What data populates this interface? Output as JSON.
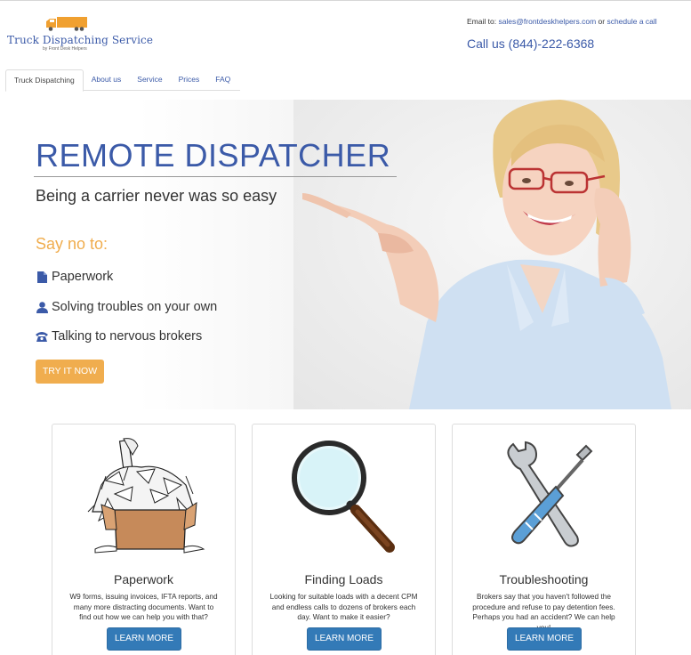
{
  "header": {
    "logo_title": "Truck Dispatching Service",
    "logo_subtitle": "by Front Desk Helpers",
    "email_prefix": "Email to: ",
    "email": "sales@frontdeskhelpers.com",
    "or_text": " or ",
    "schedule_link": "schedule a call",
    "call": "Call us (844)-222-6368"
  },
  "nav": {
    "items": [
      {
        "label": "Truck Dispatching"
      },
      {
        "label": "About us"
      },
      {
        "label": "Service"
      },
      {
        "label": "Prices"
      },
      {
        "label": "FAQ"
      }
    ]
  },
  "hero": {
    "title": "REMOTE DISPATCHER",
    "subtitle": "Being a carrier never was so easy",
    "say_no": "Say no to:",
    "bullets": [
      {
        "icon": "file-icon",
        "text": "Paperwork"
      },
      {
        "icon": "user-icon",
        "text": "Solving troubles on your own"
      },
      {
        "icon": "phone-icon",
        "text": "Talking to nervous brokers"
      }
    ],
    "cta": "TRY IT NOW"
  },
  "cards": [
    {
      "icon": "paperwork-pile-icon",
      "title": "Paperwork",
      "text": "W9 forms, issuing invoices, IFTA reports, and many more distracting documents. Want to find out how we can help you with that?",
      "button": "LEARN MORE"
    },
    {
      "icon": "magnifying-glass-icon",
      "title": "Finding Loads",
      "text": "Looking for suitable loads with a decent CPM and endless calls to dozens of brokers each day. Want to make it easier?",
      "button": "LEARN MORE"
    },
    {
      "icon": "tools-icon",
      "title": "Troubleshooting",
      "text": "Brokers say that you haven't followed the procedure and refuse to pay detention fees. Perhaps you had an accident? We can help you!",
      "button": "LEARN MORE"
    }
  ],
  "colors": {
    "brand_blue": "#3b5aa8",
    "accent_orange": "#f0ad4e",
    "button_blue": "#337ab7"
  }
}
